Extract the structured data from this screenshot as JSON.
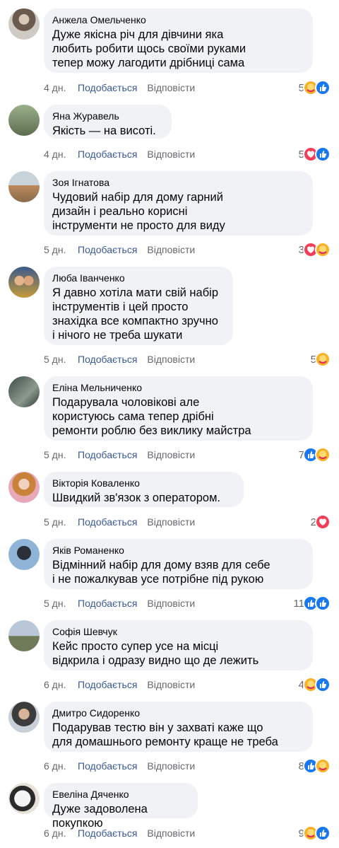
{
  "actions": {
    "like": "Подобається",
    "reply": "Відповісти"
  },
  "colors": {
    "like_blue": "#1877f2",
    "love_red": "#f33e58",
    "care_yellow": "#f7b125",
    "bubble_bg": "#f0f2f5"
  },
  "comments": [
    {
      "author": "Анжела Омельченко",
      "text": "Дуже якісна річ для дівчини яка\nлюбить робити щось своїми руками\nтепер можу лагодити дрібниці сама",
      "time": "4 дн.",
      "count": "5",
      "reactions": [
        "care-icon",
        "like-icon"
      ]
    },
    {
      "author": "Яна Журавель",
      "text": "Якість — на висоті.",
      "time": "4 дн.",
      "count": "5",
      "reactions": [
        "love-icon",
        "like-icon"
      ]
    },
    {
      "author": "Зоя Ігнатова",
      "text": "Чудовий набір для дому гарний\nдизайн і реально корисні\nінструменти не просто для виду",
      "time": "5 дн.",
      "count": "3",
      "reactions": [
        "love-icon",
        "care-icon"
      ]
    },
    {
      "author": "Люба Іванченко",
      "text": "Я давно хотіла мати свій набір\nінструментів і цей просто\nзнахідка все компактно зручно\nі нічого не треба шукати",
      "time": "5 дн.",
      "count": "5",
      "reactions": [
        "care-icon"
      ]
    },
    {
      "author": "Еліна Мельниченко",
      "text": "Подарувала чоловікові але\nкористуюсь сама тепер дрібні\nремонти роблю без виклику майстра",
      "time": "5 дн.",
      "count": "7",
      "reactions": [
        "like-icon",
        "care-icon"
      ]
    },
    {
      "author": "Вікторія Коваленко",
      "text": "Швидкий зв'язок з оператором.",
      "time": "5 дн.",
      "count": "2",
      "reactions": [
        "love-icon"
      ]
    },
    {
      "author": "Яків Романенко",
      "text": "Відмінний набір для дому взяв для себе\nі не пожалкував усе потрібне під рукою",
      "time": "5 дн.",
      "count": "11",
      "reactions": [
        "like-icon",
        "like-icon"
      ]
    },
    {
      "author": "Софія Шевчук",
      "text": "Кейс просто супер усе на місці\nвідкрила і одразу видно що де лежить",
      "time": "6 дн.",
      "count": "4",
      "reactions": [
        "care-icon",
        "like-icon"
      ]
    },
    {
      "author": "Дмитро Сидоренко",
      "text": "Подарував тестю він у захваті каже що\nдля домашнього ремонту краще не треба",
      "time": "6 дн.",
      "count": "8",
      "reactions": [
        "like-icon",
        "care-icon"
      ]
    },
    {
      "author": "Евеліна Дяченко",
      "text": "Дуже задоволена покупкою",
      "time": "6 дн.",
      "count": "9",
      "reactions": [
        "care-icon",
        "like-icon"
      ]
    }
  ]
}
